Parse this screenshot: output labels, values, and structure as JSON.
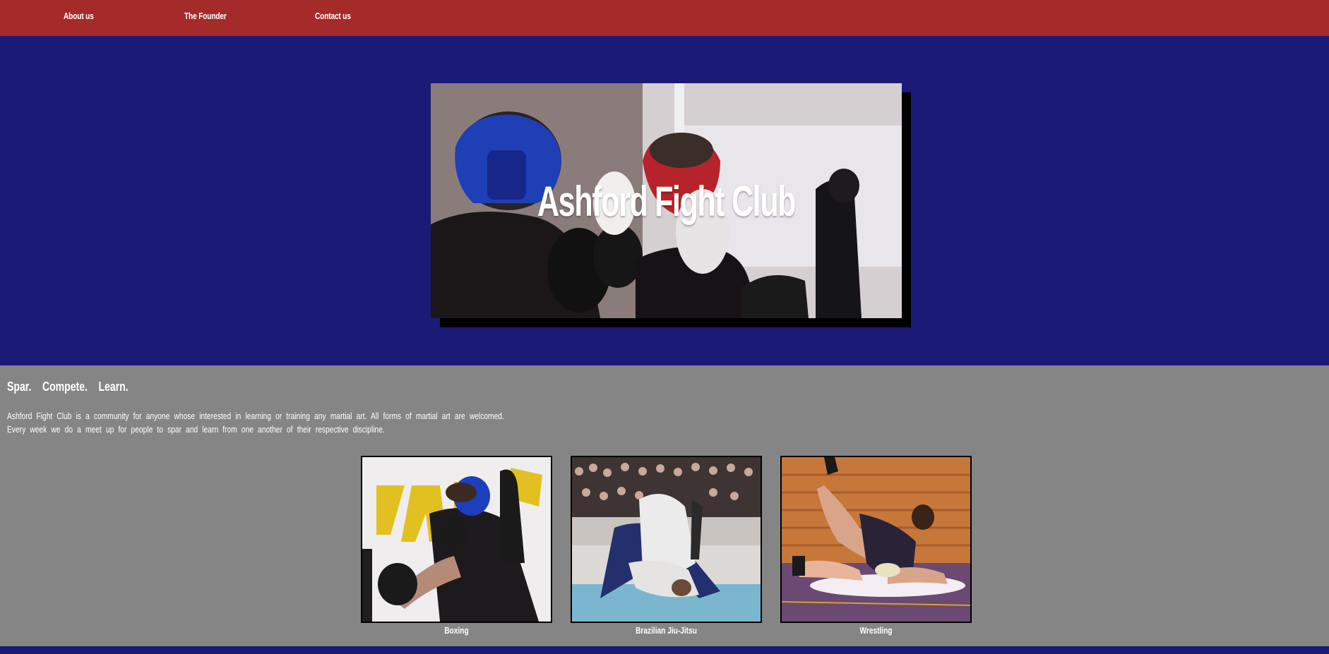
{
  "nav": {
    "items": [
      {
        "label": "About us"
      },
      {
        "label": "The Founder"
      },
      {
        "label": "Contact us"
      }
    ]
  },
  "hero": {
    "title": "Ashford Fight Club"
  },
  "intro": {
    "tagline": "Spar.    Compete.    Learn.",
    "line1": "Ashford Fight Club is a community for anyone whose interested in learning or training any martial art. All forms of martial art are welcomed.",
    "line2": "Every week we do a meet up for people to spar and learn from one another of their respective discipline."
  },
  "disciplines": [
    {
      "caption": "Boxing"
    },
    {
      "caption": "Brazilian Jiu-Jitsu"
    },
    {
      "caption": "Wrestling"
    }
  ],
  "colors": {
    "nav": "#a52a2a",
    "hero_bg": "#1b1a77",
    "section_bg": "#858585"
  }
}
